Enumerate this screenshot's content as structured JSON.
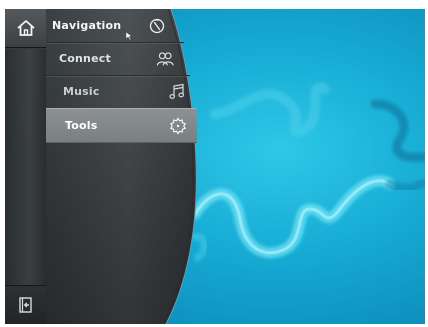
{
  "menu": {
    "items": [
      {
        "label": "Navigation",
        "icon": "compass-icon"
      },
      {
        "label": "Connect",
        "icon": "people-icon"
      },
      {
        "label": "Music",
        "icon": "music-note-icon"
      },
      {
        "label": "Tools",
        "icon": "gear-icon",
        "selected": true
      }
    ]
  },
  "strip": {
    "home_icon": "home-icon",
    "exit_icon": "exit-icon"
  },
  "colors": {
    "wallpaper": "#15a9d2",
    "selected_item": "#8c9193",
    "panel": "#3f4446"
  }
}
